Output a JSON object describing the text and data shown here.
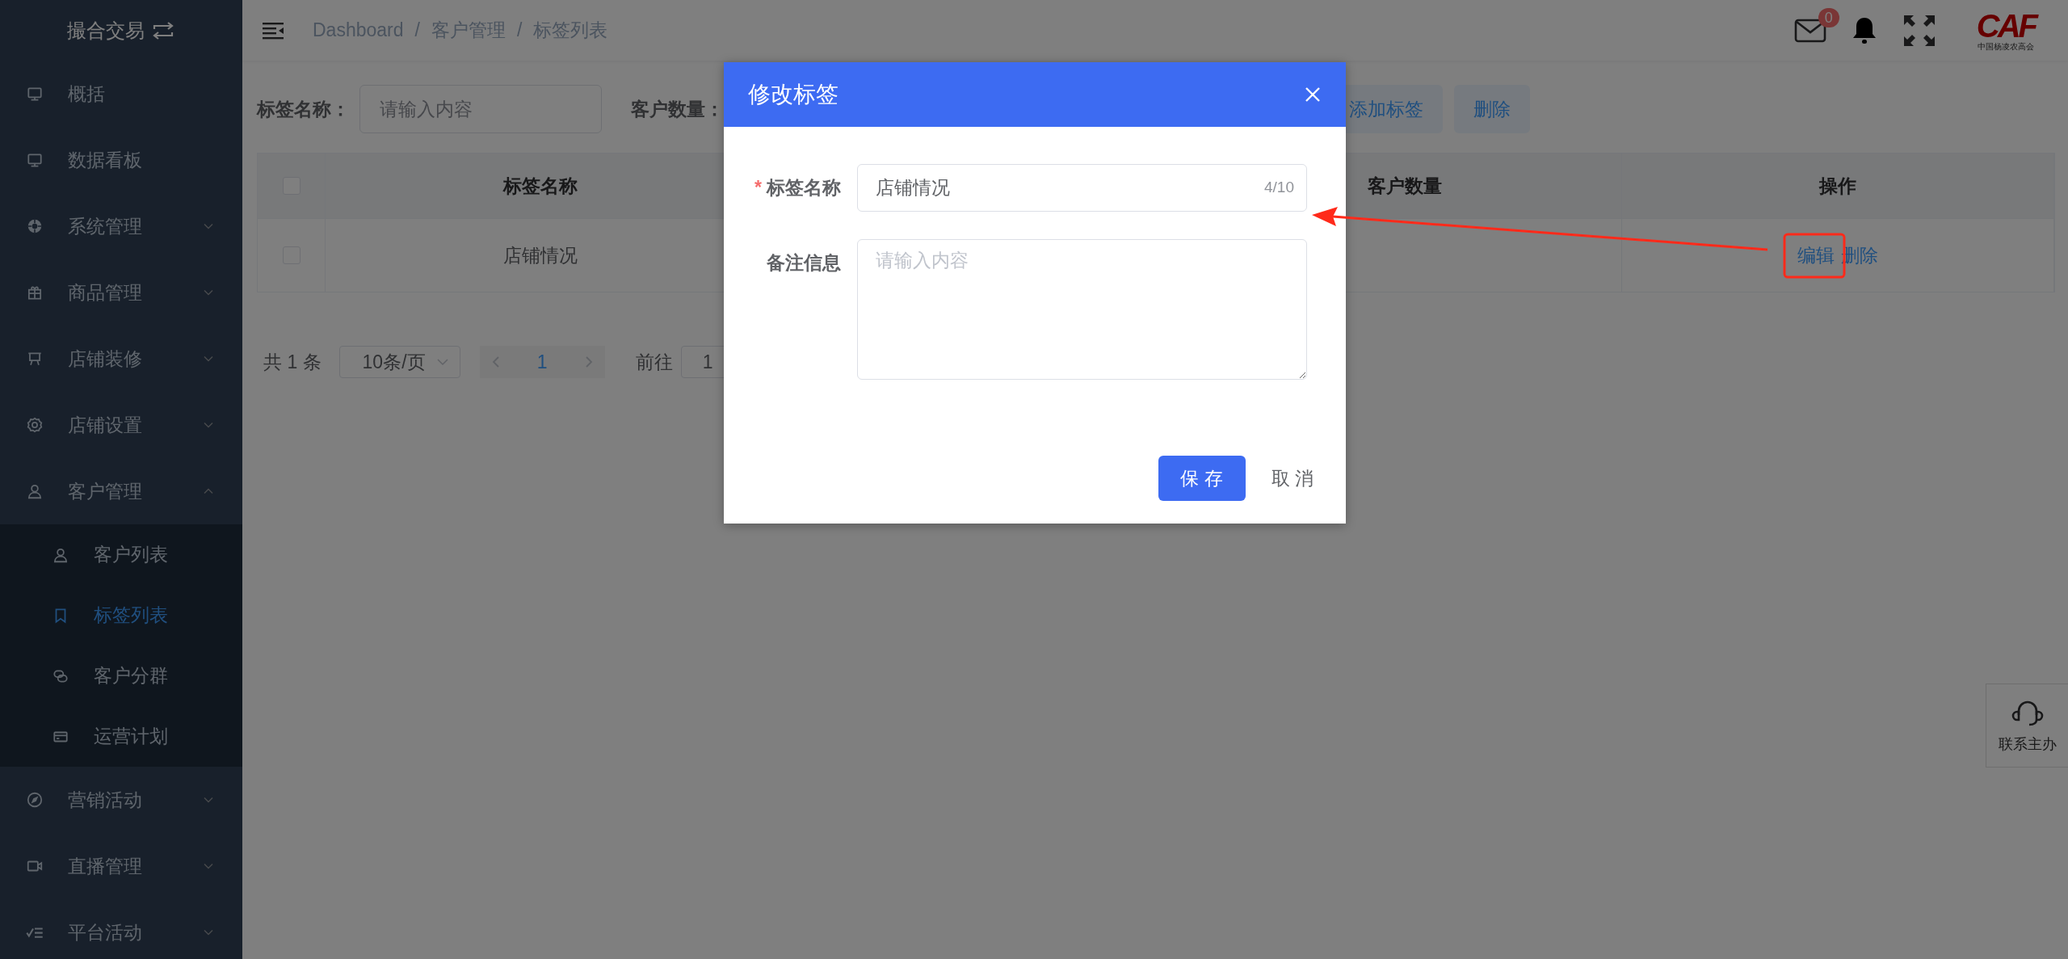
{
  "sidebar": {
    "title": "撮合交易",
    "items": [
      {
        "label": "概括"
      },
      {
        "label": "数据看板"
      },
      {
        "label": "系统管理",
        "expanded": false
      },
      {
        "label": "商品管理",
        "expanded": false
      },
      {
        "label": "店铺装修",
        "expanded": false
      },
      {
        "label": "店铺设置",
        "expanded": false
      },
      {
        "label": "客户管理",
        "expanded": true,
        "children": [
          {
            "label": "客户列表",
            "selected": false
          },
          {
            "label": "标签列表",
            "selected": true
          },
          {
            "label": "客户分群",
            "selected": false
          },
          {
            "label": "运营计划",
            "selected": false
          }
        ]
      },
      {
        "label": "营销活动",
        "expanded": false
      },
      {
        "label": "直播管理",
        "expanded": false
      },
      {
        "label": "平台活动",
        "expanded": false
      }
    ]
  },
  "header": {
    "breadcrumb": [
      {
        "label": "Dashboard",
        "separator": "/"
      },
      {
        "label": "客户管理",
        "separator": "/"
      },
      {
        "label": "标签列表"
      }
    ],
    "mail_badge": "0",
    "logo": {
      "text": "CAF",
      "caption": "中国杨凌农高会"
    }
  },
  "filters": [
    {
      "label": "标签名称：",
      "placeholder": "请输入内容"
    },
    {
      "label": "客户数量："
    }
  ],
  "actions": [
    {
      "label": "添加标签"
    },
    {
      "label": "删除"
    }
  ],
  "table": {
    "header_checked": false,
    "columns": [
      {
        "label": "标签名称"
      },
      {
        "label": "客户数量"
      },
      {
        "label": "操作"
      }
    ],
    "rows": [
      {
        "checked": false,
        "name": "店铺情况",
        "actions": [
          "编辑",
          "删除"
        ]
      }
    ]
  },
  "pagination": {
    "total": "共 1 条",
    "page_size": "10条/页",
    "pages": [
      {
        "label": "1",
        "selected": true
      }
    ],
    "goto_label": "前往",
    "goto_value": "1"
  },
  "dialog": {
    "title": "修改标签",
    "fields": [
      {
        "kind": "input",
        "label": "标签名称",
        "required_mark": "*",
        "value": "店铺情况",
        "counter": "4/10"
      },
      {
        "kind": "textarea",
        "label": "备注信息",
        "placeholder": "请输入内容"
      }
    ],
    "buttons": [
      {
        "kind": "primary",
        "label": "保 存"
      },
      {
        "kind": "text",
        "label": "取 消"
      }
    ]
  },
  "float_button": {
    "label": "联系主办"
  }
}
